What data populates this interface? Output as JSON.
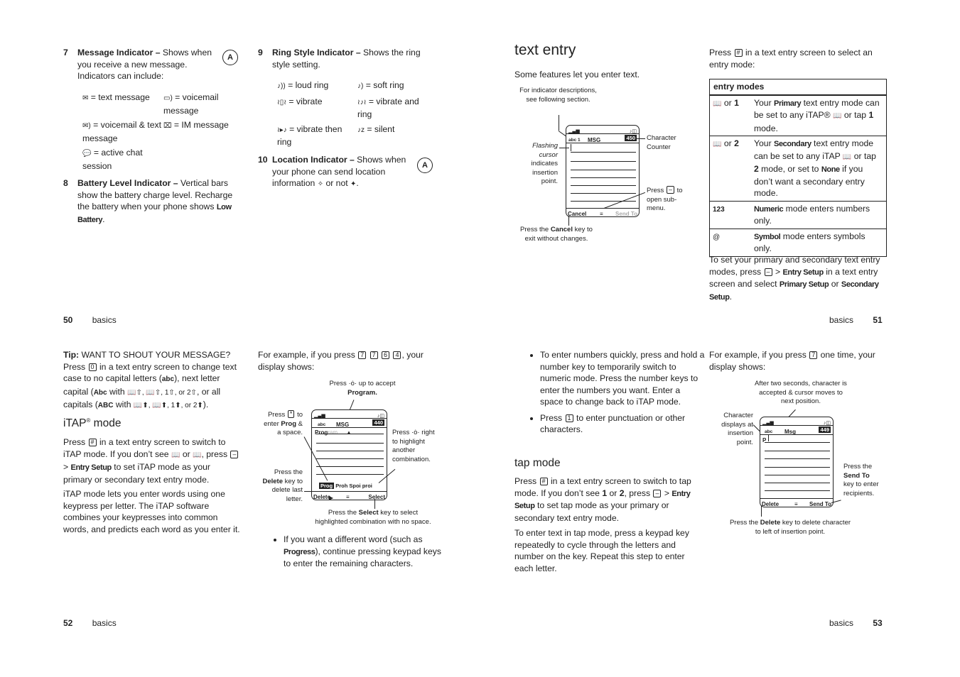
{
  "pages": {
    "p50": {
      "items": [
        {
          "num": "7",
          "title": "Message Indicator –",
          "text": " Shows when you receive a new message. Indicators can include:",
          "icon": "antenna-a-icon"
        },
        {
          "num": "8",
          "title": "Battery Level Indicator –",
          "text": " Vertical bars show the battery charge level. Recharge the battery when your phone shows ",
          "bold_end": "Low Battery",
          "end": "."
        }
      ],
      "message_indicators": [
        {
          "icon": "text-message-icon",
          "glyph": "✉",
          "label": "= text message"
        },
        {
          "icon": "voicemail-icon",
          "glyph": "☏",
          "label": "= voicemail message"
        },
        {
          "icon": "voicemail-text-icon",
          "glyph": "✉",
          "label": "= voicemail & text message"
        },
        {
          "icon": "im-message-icon",
          "glyph": "⌧",
          "label": "= IM message"
        },
        {
          "icon": "active-chat-icon",
          "glyph": "💬",
          "label": "= active chat session"
        }
      ],
      "footer": {
        "page": "50",
        "section": "basics"
      }
    },
    "p50b": {
      "items": [
        {
          "num": "9",
          "title": "Ring Style Indicator –",
          "text": " Shows the ring style setting."
        },
        {
          "num": "10",
          "title": "Location Indicator –",
          "text": " Shows when your phone can send location information ",
          "mid": " or not ",
          "end": "."
        }
      ],
      "ring_styles": [
        {
          "icon": "loud-ring-icon",
          "glyph": "🔔",
          "label": "= loud ring"
        },
        {
          "icon": "soft-ring-icon",
          "glyph": "🔔",
          "label": "= soft ring"
        },
        {
          "icon": "vibrate-icon",
          "glyph": "📳",
          "label": "= vibrate"
        },
        {
          "icon": "vibrate-and-ring-icon",
          "glyph": "📳",
          "label": "= vibrate and ring"
        },
        {
          "icon": "vibrate-then-ring-icon",
          "glyph": "📳",
          "label": "= vibrate then ring"
        },
        {
          "icon": "silent-icon",
          "glyph": "🔕",
          "label": "= silent"
        }
      ]
    },
    "p51": {
      "title": "text entry",
      "intro": "Some features let you enter text.",
      "diagram": {
        "cap_top": "For indicator descriptions, see following section.",
        "cap_cursor_italic": "Flashing cursor",
        "cap_cursor": "indicates insertion point.",
        "cap_counter": "Character Counter",
        "cap_submenu_a": "Press",
        "cap_submenu_b": "to open sub-menu.",
        "cap_cancel_a": "Press the",
        "cap_cancel_key": "Cancel",
        "cap_cancel_b": "key to exit without changes.",
        "screen": {
          "mode": "abc 1",
          "title": "MSG",
          "counter": "450",
          "left_soft": "Cancel",
          "right_soft": "Send To"
        }
      },
      "right_intro_a": "Press",
      "right_intro_key": "#",
      "right_intro_b": "in a text entry screen to select an entry mode:",
      "table": {
        "header": "entry modes",
        "rows": [
          {
            "mode_a": "or",
            "mode_num": "1",
            "desc_a": "Your ",
            "desc_bold": "Primary",
            "desc_b": " text entry mode can be set to any iTAP® ",
            "desc_c": " or tap ",
            "desc_num": "1",
            "desc_d": " mode."
          },
          {
            "mode_a": "or",
            "mode_num": "2",
            "desc_a": "Your ",
            "desc_bold": "Secondary",
            "desc_b": " text entry mode can be set to any iTAP ",
            "desc_c": " or tap ",
            "desc_num": "2",
            "desc_d": " mode, or set to ",
            "desc_bold2": "None",
            "desc_e": " if you don’t want a secondary entry mode."
          },
          {
            "mode": "123",
            "desc_bold": "Numeric",
            "desc": " mode enters numbers only."
          },
          {
            "mode": "@",
            "desc_bold": "Symbol",
            "desc": " mode enters symbols only."
          }
        ]
      },
      "setup_a": "To set your primary and secondary text entry modes, press",
      "setup_b": ">",
      "setup_bold1": "Entry Setup",
      "setup_c": " in a text entry screen and select ",
      "setup_bold2": "Primary Setup",
      "setup_d": " or ",
      "setup_bold3": "Secondary Setup",
      "setup_e": ".",
      "footer": {
        "page": "51",
        "section": "basics"
      }
    },
    "p52": {
      "tip_label": "Tip:",
      "tip_a": " WANT TO SHOUT YOUR MESSAGE? Press ",
      "tip_key": "0",
      "tip_b": " in a text entry screen to change text case to no capital letters (",
      "tip_abc": "abc",
      "tip_c": "), next letter capital (",
      "tip_Abc": "Abc",
      "tip_d": " with ",
      "tip_e": ", or all capitals (",
      "tip_ABC": "ABC",
      "tip_f": ").",
      "heading": "iTAP",
      "heading_sup": "®",
      "heading_rest": " mode",
      "para1_a": "Press ",
      "para1_key": "#",
      "para1_b": " in a text entry screen to switch to iTAP mode. If you don’t see ",
      "para1_c": " or ",
      "para1_d": ", press ",
      "para1_e": " > ",
      "para1_bold": "Entry Setup",
      "para1_f": " to set iTAP mode as your primary or secondary text entry mode.",
      "para2": "iTAP mode lets you enter words using one keypress per letter. The iTAP software combines your keypresses into common words, and predicts each word as you enter it.",
      "example_a": "For example, if you press ",
      "example_keys": [
        "7",
        "7",
        "6",
        "4"
      ],
      "example_b": ", your display shows:",
      "diagram": {
        "cap_accept_a": "Press",
        "cap_accept_b": "up to accept",
        "cap_accept_bold": "Program.",
        "cap_star_a": "Press",
        "cap_star_key": "*",
        "cap_star_b": "to enter",
        "cap_star_bold": "Prog",
        "cap_star_c": "& a space.",
        "cap_right_a": "Press",
        "cap_right_b": "right to highlight another combination.",
        "cap_delete_a": "Press the",
        "cap_delete_bold": "Delete",
        "cap_delete_b": "key to delete last letter.",
        "cap_select_a": "Press the",
        "cap_select_bold": "Select",
        "cap_select_b": "key to select highlighted combination with no space.",
        "screen": {
          "mode": "abc",
          "title": "MSG",
          "counter": "440",
          "typed": "Prog",
          "suggest": "ram",
          "combos_hl": "Prog",
          "combos": "Proh Spoi proi",
          "left_soft": "Delete",
          "right_soft": "Select"
        }
      },
      "bullet_a": "If you want a different word (such as ",
      "bullet_bold": "Progress",
      "bullet_b": "), continue pressing keypad keys to enter the remaining characters.",
      "footer": {
        "page": "52",
        "section": "basics"
      }
    },
    "p53": {
      "bullets": [
        "To enter numbers quickly, press and hold a number key to temporarily switch to numeric mode. Press the number keys to enter the numbers you want. Enter a space to change back to iTAP mode."
      ],
      "bullet2_a": "Press ",
      "bullet2_key": "1",
      "bullet2_b": " to enter punctuation or other characters.",
      "heading": "tap mode",
      "para1_a": "Press ",
      "para1_key": "#",
      "para1_b": " in a text entry screen to switch to tap mode. If you don’t see ",
      "para1_n1": "1",
      "para1_c": " or ",
      "para1_n2": "2",
      "para1_d": ", press ",
      "para1_e": " > ",
      "para1_bold": "Entry Setup",
      "para1_f": " to set tap mode as your primary or secondary text entry mode.",
      "para2": "To enter text in tap mode, press a keypad key repeatedly to cycle through the letters and number on the key. Repeat this step to enter each letter.",
      "example_a": "For example, if you press ",
      "example_key": "7",
      "example_b": " one time, your display shows:",
      "diagram": {
        "cap_top": "After two seconds, character is accepted & cursor moves to next position.",
        "cap_char": "Character displays at insertion point.",
        "cap_send_a": "Press the",
        "cap_send_bold": "Send To",
        "cap_send_b": "key to enter recipients.",
        "cap_delete_a": "Press the",
        "cap_delete_bold": "Delete",
        "cap_delete_b": "key to delete character to left of insertion point.",
        "screen": {
          "mode": "abc",
          "title": "Msg",
          "counter": "449",
          "typed": "P",
          "left_soft": "Delete",
          "right_soft": "Send To"
        }
      },
      "footer": {
        "page": "53",
        "section": "basics"
      }
    }
  }
}
